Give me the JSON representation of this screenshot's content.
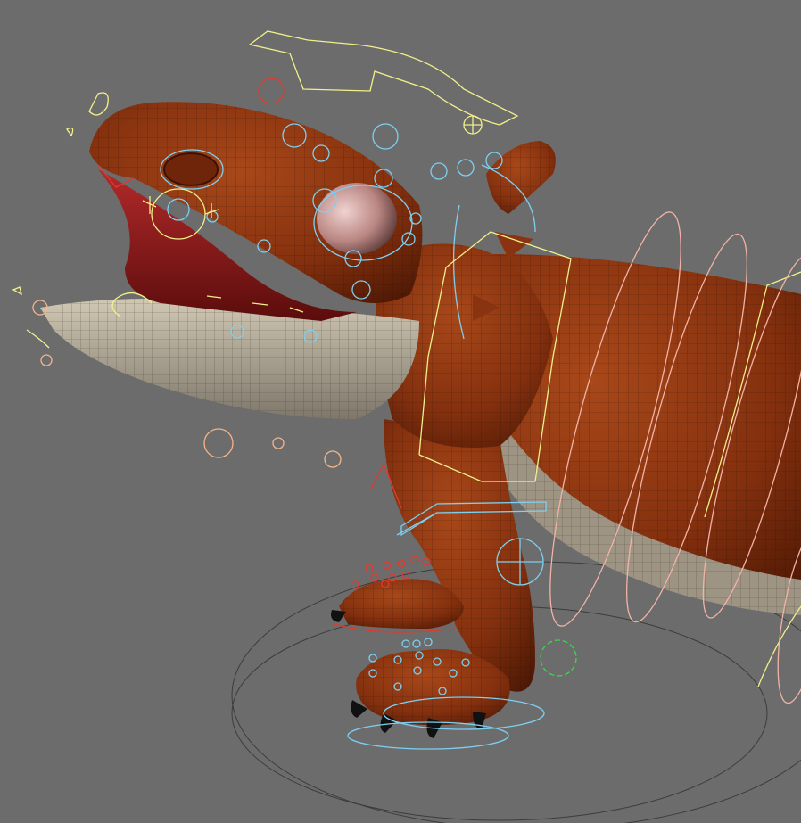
{
  "viewport": {
    "background": "#6c6c6c",
    "subject": "creature-model"
  },
  "colors": {
    "skin": "#8a3310",
    "skin_dark": "#5a1e06",
    "belly": "#b5ab98",
    "mouth": "#9a1c1c",
    "control_blue": "#7ecff0",
    "control_yellow": "#f2f08a",
    "control_red": "#e03a2e",
    "control_pink": "#f2b3a6",
    "control_orange": "#f4b58a",
    "control_green": "#3ad84a"
  }
}
